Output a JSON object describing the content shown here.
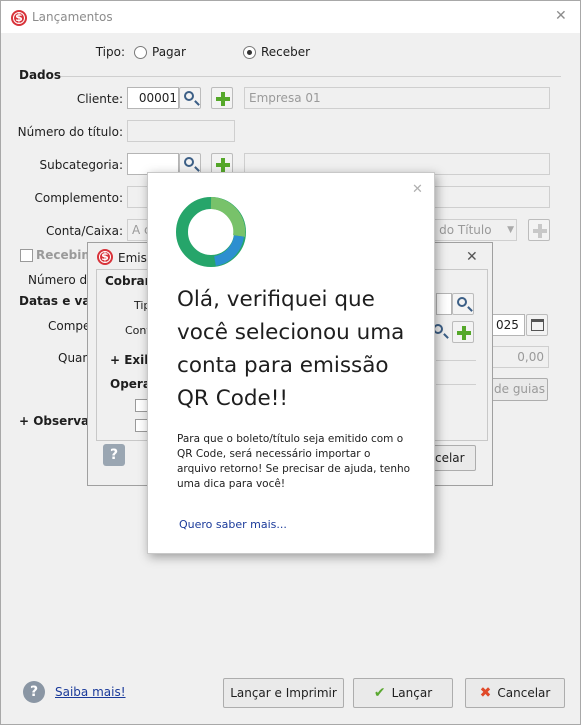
{
  "window": {
    "title": "Lançamentos"
  },
  "tipo": {
    "label": "Tipo:",
    "options": [
      "Pagar",
      "Receber"
    ],
    "selected": "Receber"
  },
  "dados": {
    "section": "Dados",
    "cliente_label": "Cliente:",
    "cliente_code": "00001",
    "cliente_name": "Empresa 01",
    "numero_titulo_label": "Número do título:",
    "subcategoria_label": "Subcategoria:",
    "complemento_label": "Complemento:",
    "conta_caixa_label": "Conta/Caixa:",
    "conta_caixa_value_left": "A c",
    "conta_caixa_value_right": "o do Título",
    "recebimento_label": "Recebime",
    "numero_do_label": "Número do"
  },
  "datas": {
    "section": "Datas e valor",
    "compet_label": "Compet",
    "date_fragment": "025",
    "quant_label": "Quant",
    "value": "0,00",
    "guias_button": "de guias"
  },
  "observacao": {
    "label": "+ Observaçã"
  },
  "emissao_dialog": {
    "title": "Emiss",
    "cobranca": "Cobranç",
    "tipo_label": "Tip",
    "conta_label": "Cont",
    "exibir": "+ Exibi",
    "operacoes": "Operac",
    "cancelar": "ncelar"
  },
  "popup": {
    "title": "Olá, verifiquei que você selecionou uma conta para emissão QR Code!!",
    "body": "Para que o boleto/título seja emitido com o QR Code, será necessário importar o arquivo retorno! Se precisar de ajuda, tenho uma dica para você!",
    "link": "Quero saber mais...",
    "colors": {
      "ring_outer": "#1aa56b",
      "ring_inner": "#2d8fd0",
      "link": "#1a3a9a"
    }
  },
  "footer": {
    "help_link": "Saiba mais!",
    "launch_print": "Lançar e Imprimir",
    "launch": "Lançar",
    "cancel": "Cancelar"
  }
}
